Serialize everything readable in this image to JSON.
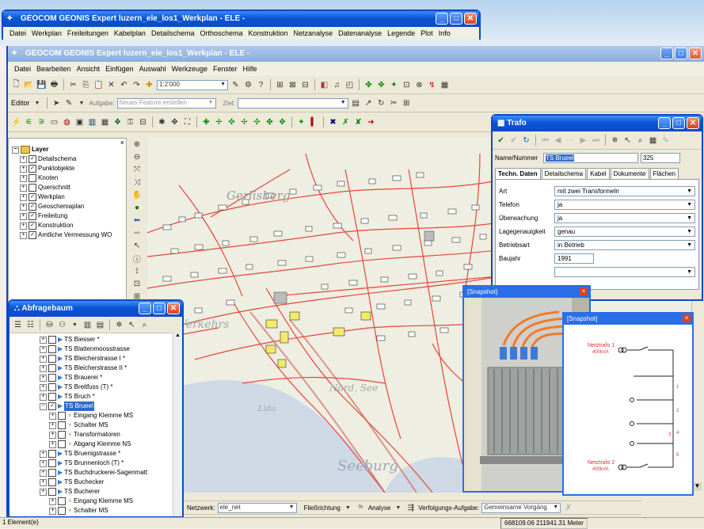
{
  "colors": {
    "xp_blue": "#0a55d6",
    "map_line": "#e8443a",
    "water": "#cfd9e6",
    "land": "#eeeee2",
    "building": "#f2ea6a"
  },
  "top_window": {
    "title": "GEOCOM GEONIS Expert luzern_ele_los1_Werkplan - ELE -",
    "menu": [
      "Datei",
      "Werkplan",
      "Freileitungen",
      "Kabelplan",
      "Detailschema",
      "Orthoschema",
      "Konstruktion",
      "Netzanalyse",
      "Datenanalyse",
      "Legende",
      "Plot",
      "Info"
    ]
  },
  "main_window": {
    "title": "GEOCOM GEONIS Expert luzern_ele_los1_Werkplan - ELE -",
    "menu": [
      "Datei",
      "Bearbeiten",
      "Ansicht",
      "Einfügen",
      "Auswahl",
      "Werkzeuge",
      "Fenster",
      "Hilfe"
    ],
    "scale": "1:2'000",
    "editor_label": "Editor",
    "task_label": "Aufgabe:",
    "task_value": "Neues Feature erstellen",
    "target_label": "Ziel:"
  },
  "layers": {
    "root": "Layer",
    "items": [
      {
        "label": "Detailschema",
        "checked": true
      },
      {
        "label": "Punktobjekte",
        "checked": true
      },
      {
        "label": "Knoten",
        "checked": false
      },
      {
        "label": "Querschnitt",
        "checked": false
      },
      {
        "label": "Werkplan",
        "checked": true
      },
      {
        "label": "Geoschemaplan",
        "checked": true
      },
      {
        "label": "Freileitung",
        "checked": true
      },
      {
        "label": "Konstruktion",
        "checked": true
      },
      {
        "label": "Amtliche Vermessung WO",
        "checked": true
      }
    ]
  },
  "map_labels": {
    "gerlisberg": "Gerlisberg",
    "werkehr": "Verkehrs",
    "lido": "Lido",
    "seeburg": "Seeburg",
    "tribschen": "Nord. See"
  },
  "trafo": {
    "title": "Trafo",
    "name_label": "Name/Nummer",
    "name_value": "TS Brueel",
    "number_value": "325",
    "tabs": [
      "Techn. Daten",
      "Detailschema",
      "Kabel",
      "Dokumente",
      "Flächen"
    ],
    "fields": [
      {
        "label": "Art",
        "value": "mit zwei Transformeln",
        "dropdown": true
      },
      {
        "label": "Telefon",
        "value": "ja",
        "dropdown": true
      },
      {
        "label": "Überwachung",
        "value": "ja",
        "dropdown": true
      },
      {
        "label": "Lagegenauigkeit",
        "value": "genau",
        "dropdown": true
      },
      {
        "label": "Betriebsart",
        "value": "in Betrieb",
        "dropdown": true
      },
      {
        "label": "Baujahr",
        "value": "1991",
        "dropdown": false
      }
    ]
  },
  "abfrage": {
    "title": "Abfragebaum",
    "items": [
      {
        "label": "TS Biesser *",
        "level": 0
      },
      {
        "label": "TS Blattenmoosstrasse",
        "level": 0
      },
      {
        "label": "TS Bleicherstrasse I *",
        "level": 0
      },
      {
        "label": "TS Bleicherstrasse II *",
        "level": 0
      },
      {
        "label": "TS Brauerei *",
        "level": 0
      },
      {
        "label": "TS Breitfuss (T) *",
        "level": 0
      },
      {
        "label": "TS Bruch *",
        "level": 0
      },
      {
        "label": "TS Brueel",
        "level": 0,
        "selected": true
      },
      {
        "label": "Eingang Klemme MS",
        "level": 1
      },
      {
        "label": "Schalter MS",
        "level": 1
      },
      {
        "label": "Transformatoren",
        "level": 1
      },
      {
        "label": "Abgang Klemme NS",
        "level": 1
      },
      {
        "label": "TS Bruenigstrasse *",
        "level": 0
      },
      {
        "label": "TS Brunnenloch (T) *",
        "level": 0
      },
      {
        "label": "TS Buchdruckerei-Sagenmatt",
        "level": 0
      },
      {
        "label": "TS Buchecker",
        "level": 0
      },
      {
        "label": "TS Bucherer",
        "level": 0
      },
      {
        "label": "Eingang Klemme MS",
        "level": 1
      },
      {
        "label": "Schalter MS",
        "level": 1
      }
    ]
  },
  "snapshot1": {
    "title": "[Snapshot]"
  },
  "snapshot2": {
    "title": "[Snapshot]",
    "netz1": "Netztrafo 1",
    "netz1_power": "400kVA",
    "netz2": "Netztrafo 2",
    "netz2_power": "400kVA",
    "numbers": [
      "1",
      "2",
      "3",
      "4",
      "5"
    ]
  },
  "bottom": {
    "netzwerk_label": "Netzwerk:",
    "netzwerk_value": "ele_net",
    "fliess": "Fließrichtung",
    "analyse": "Analyse",
    "verfolgung": "Verfolgungs-Aufgabe:",
    "verfolgung_value": "Gemeinsame Vorgäng",
    "status": "1 Element(e)",
    "coords": "668109.06 211941.31 Meter"
  }
}
